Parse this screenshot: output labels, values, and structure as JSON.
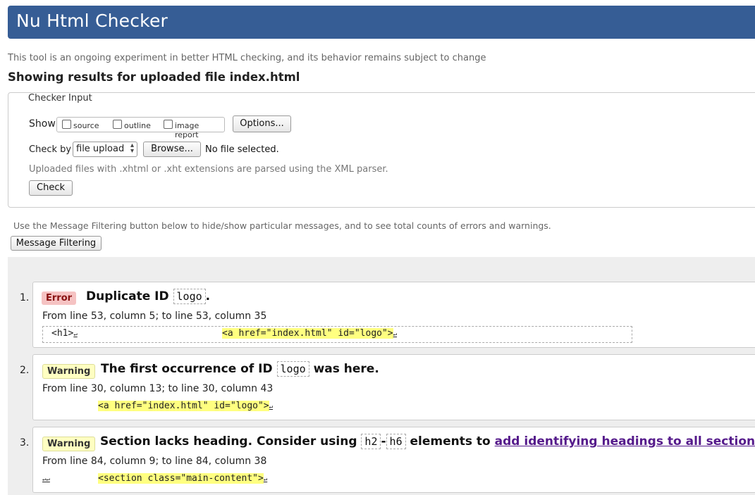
{
  "header": {
    "title": "Nu Html Checker"
  },
  "intro": "This tool is an ongoing experiment in better HTML checking, and its behavior remains subject to change",
  "results_title": "Showing results for uploaded file index.html",
  "checker_input": {
    "legend": "Checker Input",
    "show_label": "Show",
    "show_options": [
      "source",
      "outline",
      "image report"
    ],
    "options_button": "Options...",
    "check_by_label": "Check by",
    "check_by_value": "file upload",
    "browse_button": "Browse...",
    "file_status": "No file selected.",
    "parser_note": "Uploaded files with .xhtml or .xht extensions are parsed using the XML parser.",
    "check_button": "Check"
  },
  "filter_note": "Use the Message Filtering button below to hide/show particular messages, and to see total counts of errors and warnings.",
  "filter_button": "Message Filtering",
  "messages": [
    {
      "number": "1.",
      "type": "Error",
      "text_before": "Duplicate ID",
      "code": "logo",
      "text_after": ".",
      "location": "From line 53, column 5; to line 53, column 35",
      "extract_pre": "<h1>",
      "extract_hl": "<a href=\"index.html\" id=\"logo\">"
    },
    {
      "number": "2.",
      "type": "Warning",
      "text_before": "The first occurrence of ID",
      "code": "logo",
      "text_after": "was here.",
      "location": "From line 30, column 13; to line 30, column 43",
      "extract_hl": "<a href=\"index.html\" id=\"logo\">"
    },
    {
      "number": "3.",
      "type": "Warning",
      "text_before": "Section lacks heading. Consider using",
      "code": "h2",
      "dash": "-",
      "code2": "h6",
      "text_mid": "elements to",
      "link": "add identifying headings to all sections",
      "text_after": ".",
      "location": "From line 84, column 9; to line 84, column 38",
      "extract_hl": "<section class=\"main-content\">"
    }
  ],
  "line_feed_symbol": "↵"
}
